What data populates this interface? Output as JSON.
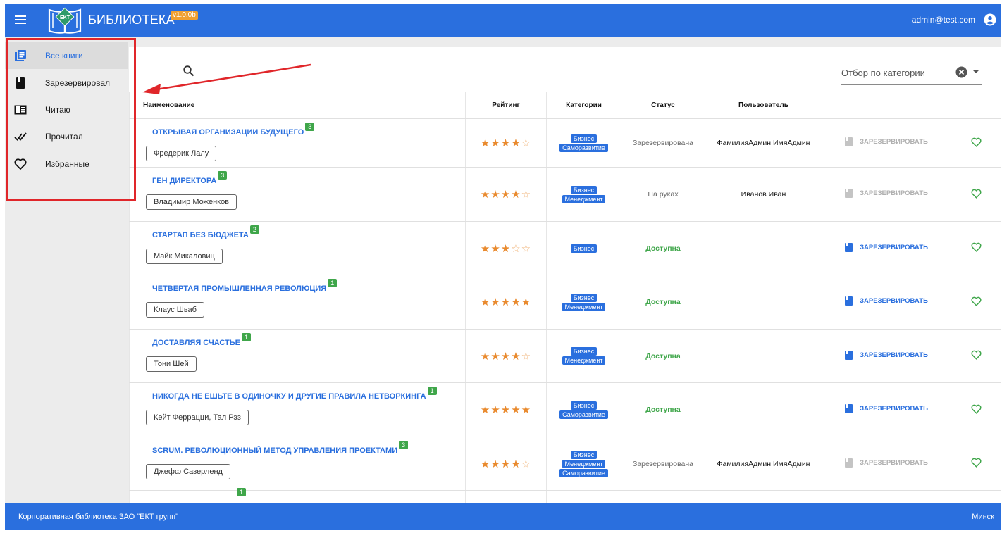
{
  "header": {
    "title": "БИБЛИОТЕКА",
    "version": "v1.0.0b",
    "user_email": "admin@test.com",
    "logo_text": "EKT"
  },
  "sidebar": {
    "items": [
      {
        "label": "Все книги",
        "icon": "library-books-icon",
        "active": true
      },
      {
        "label": "Зарезервировал",
        "icon": "book-icon",
        "active": false
      },
      {
        "label": "Читаю",
        "icon": "chrome-reader-icon",
        "active": false
      },
      {
        "label": "Прочитал",
        "icon": "done-all-icon",
        "active": false
      },
      {
        "label": "Избранные",
        "icon": "heart-outline-icon",
        "active": false
      }
    ]
  },
  "filters": {
    "search_placeholder": "",
    "category_label": "Отбор по категории"
  },
  "table": {
    "headers": [
      "Наименование",
      "Рейтинг",
      "Категории",
      "Статус",
      "Пользователь",
      "",
      ""
    ],
    "reserve_label": "ЗАРЕЗЕРВИРОВАТЬ",
    "rows": [
      {
        "title": "ОТКРЫВАЯ ОРГАНИЗАЦИИ БУДУЩЕГО",
        "count": "3",
        "author": "Фредерик Лалу",
        "rating": 4,
        "categories": [
          "Бизнес",
          "Саморазвитие"
        ],
        "status": "Зарезервирована",
        "status_type": "muted",
        "user": "ФамилияАдмин ИмяАдмин",
        "reservable": false
      },
      {
        "title": "ГЕН ДИРЕКТОРА",
        "count": "3",
        "author": "Владимир Моженков",
        "rating": 4,
        "categories": [
          "Бизнес",
          "Менеджмент"
        ],
        "status": "На руках",
        "status_type": "muted",
        "user": "Иванов Иван",
        "reservable": false
      },
      {
        "title": "СТАРТАП БЕЗ БЮДЖЕТА",
        "count": "2",
        "author": "Майк Микаловиц",
        "rating": 3,
        "categories": [
          "Бизнес"
        ],
        "status": "Доступна",
        "status_type": "available",
        "user": "",
        "reservable": true
      },
      {
        "title": "ЧЕТВЕРТАЯ ПРОМЫШЛЕННАЯ РЕВОЛЮЦИЯ",
        "count": "1",
        "author": "Клаус Шваб",
        "rating": 5,
        "categories": [
          "Бизнес",
          "Менеджмент"
        ],
        "status": "Доступна",
        "status_type": "available",
        "user": "",
        "reservable": true
      },
      {
        "title": "ДОСТАВЛЯЯ СЧАСТЬЕ",
        "count": "1",
        "author": "Тони Шей",
        "rating": 4,
        "categories": [
          "Бизнес",
          "Менеджмент"
        ],
        "status": "Доступна",
        "status_type": "available",
        "user": "",
        "reservable": true
      },
      {
        "title": "НИКОГДА НЕ ЕШЬТЕ В ОДИНОЧКУ И ДРУГИЕ ПРАВИЛА НЕТВОРКИНГА",
        "count": "1",
        "author": "Кейт Феррацци, Тал Рэз",
        "rating": 5,
        "categories": [
          "Бизнес",
          "Саморазвитие"
        ],
        "status": "Доступна",
        "status_type": "available",
        "user": "",
        "reservable": true
      },
      {
        "title": "SCRUM. РЕВОЛЮЦИОННЫЙ МЕТОД УПРАВЛЕНИЯ ПРОЕКТАМИ",
        "count": "3",
        "author": "Джефф Сазерленд",
        "rating": 4,
        "categories": [
          "Бизнес",
          "Менеджмент",
          "Саморазвитие"
        ],
        "status": "Зарезервирована",
        "status_type": "muted",
        "user": "ФамилияАдмин ИмяАдмин",
        "reservable": false
      },
      {
        "title": "",
        "count": "1",
        "author": "",
        "rating": 0,
        "categories": [],
        "status": "",
        "status_type": "muted",
        "user": "",
        "reservable": false,
        "partial": true
      }
    ]
  },
  "footer": {
    "left": "Корпоративная библиотека ЗАО \"ЕКТ групп\"",
    "right": "Минск"
  },
  "colors": {
    "primary": "#2a6fde",
    "available": "#3fa64a",
    "star": "#e98a2e",
    "annotation": "#e0262a",
    "version_badge": "#f0a030"
  }
}
